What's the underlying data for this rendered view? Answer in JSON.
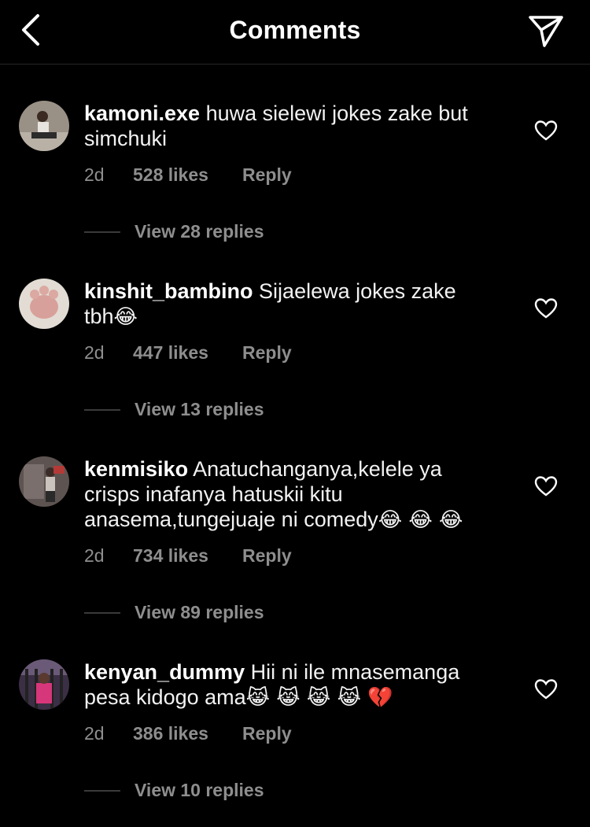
{
  "header": {
    "title": "Comments",
    "back_icon": "chevron-left-icon",
    "send_icon": "paper-plane-icon"
  },
  "comments": [
    {
      "username": "kamoni.exe",
      "text_line1": "huwa sielewi jokes zake  but",
      "text_line2": "simchuki",
      "emojis": "",
      "time": "2d",
      "likes": "528 likes",
      "reply": "Reply",
      "view_replies": "View 28 replies"
    },
    {
      "username": "kinshit_bambino",
      "text_line1": "Sijaelewa jokes zake",
      "text_line2": "tbh",
      "emojis": "😂",
      "time": "2d",
      "likes": "447 likes",
      "reply": "Reply",
      "view_replies": "View 13 replies"
    },
    {
      "username": "kenmisiko",
      "text_line1": "Anatuchanganya,kelele ya",
      "text_line2": "crisps inafanya hatuskii kitu",
      "text_line3": "anasema,tungejuaje ni comedy",
      "emojis": "😂 😂 😂",
      "time": "2d",
      "likes": "734 likes",
      "reply": "Reply",
      "view_replies": "View 89 replies"
    },
    {
      "username": "kenyan_dummy",
      "text_line1": "Hii ni ile mnasemanga",
      "text_line2": "pesa kidogo ama",
      "emojis": "😹 😹 😹 😹 💔",
      "time": "2d",
      "likes": "386 likes",
      "reply": "Reply",
      "view_replies": "View 10 replies"
    }
  ],
  "colors": {
    "background": "#000000",
    "text": "#ffffff",
    "secondary": "#8e8e8e",
    "divider": "#262626"
  }
}
